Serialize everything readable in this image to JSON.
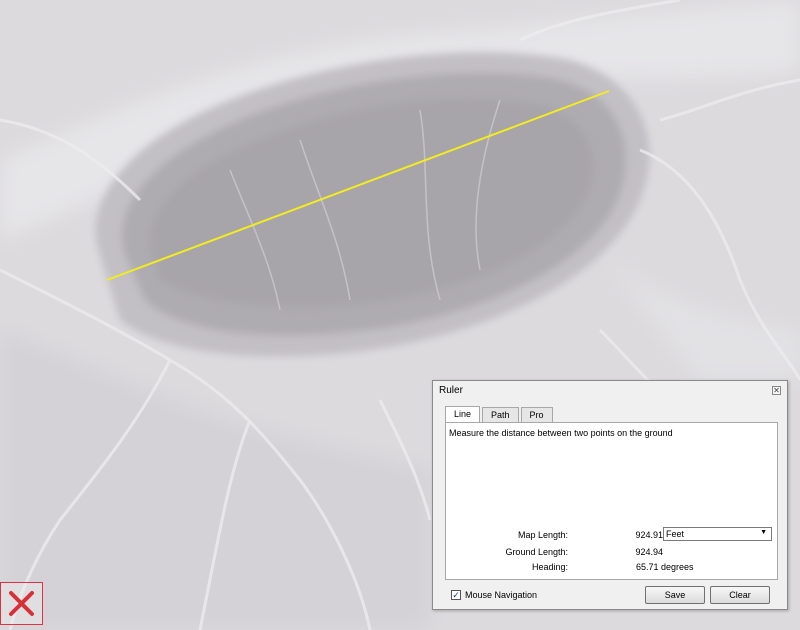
{
  "ruler": {
    "title": "Ruler",
    "tabs": [
      {
        "label": "Line",
        "active": true
      },
      {
        "label": "Path",
        "active": false
      },
      {
        "label": "Pro",
        "active": false
      }
    ],
    "description": "Measure the distance between two points on the ground",
    "map_length_label": "Map Length:",
    "map_length_value": "924.91",
    "unit": "Feet",
    "ground_length_label": "Ground Length:",
    "ground_length_value": "924.94",
    "heading_label": "Heading:",
    "heading_value": "65.71 degrees",
    "mouse_navigation_label": "Mouse Navigation",
    "mouse_navigation_checked": true,
    "save_label": "Save",
    "clear_label": "Clear"
  },
  "measure_line_color": "#f4ec1c",
  "exit_icon": "close-x-icon",
  "exit_color": "#d83038"
}
